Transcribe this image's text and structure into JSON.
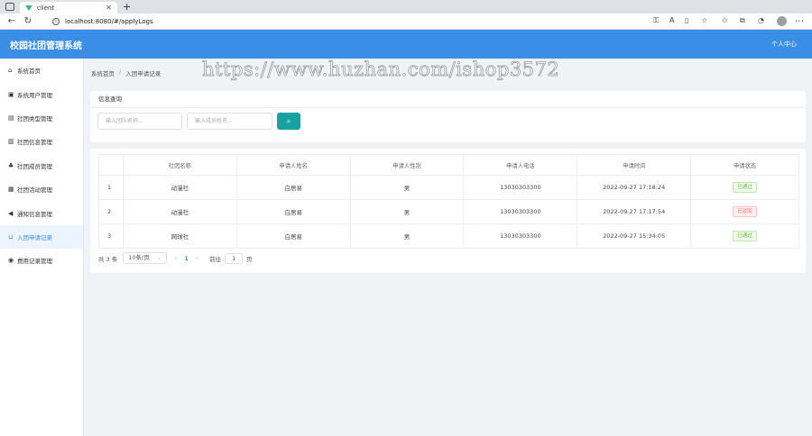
{
  "browser": {
    "tab_title": "client",
    "url": "localhost:8080/#/applyLogs"
  },
  "app": {
    "title": "校园社团管理系统",
    "user_center": "个人中心"
  },
  "sidebar": {
    "items": [
      {
        "icon": "home-icon",
        "glyph": "⌂",
        "label": "系统首页"
      },
      {
        "icon": "document-icon",
        "glyph": "▣",
        "label": "系统用户管理"
      },
      {
        "icon": "list-icon",
        "glyph": "▤",
        "label": "社团类型管理"
      },
      {
        "icon": "info-icon",
        "glyph": "▥",
        "label": "社团信息管理"
      },
      {
        "icon": "users-icon",
        "glyph": "♣",
        "label": "社团成员管理"
      },
      {
        "icon": "calendar-icon",
        "glyph": "▦",
        "label": "社团活动管理"
      },
      {
        "icon": "megaphone-icon",
        "glyph": "◀",
        "label": "通知信息管理"
      },
      {
        "icon": "tray-icon",
        "glyph": "⊔",
        "label": "入团申请记录"
      },
      {
        "icon": "money-icon",
        "glyph": "◉",
        "label": "费用记录管理"
      }
    ],
    "active_index": 7
  },
  "breadcrumb": {
    "home": "系统首页",
    "separator": "/",
    "current": "入团申请记录"
  },
  "watermark": "https://www.huzhan.com/ishop3572",
  "search": {
    "header": "信息查询",
    "team_placeholder": "输入团队名称...",
    "member_placeholder": "输入成员姓名..."
  },
  "table": {
    "columns": [
      "",
      "社团名称",
      "申请人姓名",
      "申请人性别",
      "申请人电话",
      "申请时间",
      "申请状态"
    ],
    "rows": [
      {
        "index": "1",
        "club": "动漫社",
        "name": "白居易",
        "gender": "男",
        "phone": "13030303300",
        "time": "2022-09-27 17:18:24",
        "status": "已通过",
        "status_type": "ok"
      },
      {
        "index": "2",
        "club": "动漫社",
        "name": "白居易",
        "gender": "男",
        "phone": "13030303300",
        "time": "2022-09-27 17:17:54",
        "status": "已驳回",
        "status_type": "rej"
      },
      {
        "index": "3",
        "club": "网球社",
        "name": "白居易",
        "gender": "男",
        "phone": "13030303300",
        "time": "2022-09-27 15:34:05",
        "status": "已通过",
        "status_type": "ok"
      }
    ]
  },
  "pagination": {
    "total": "共 3 条",
    "page_size": "10条/页",
    "current_page": "1",
    "goto_label": "前往",
    "goto_value": "1",
    "page_suffix": "页"
  },
  "colors": {
    "header_blue": "#3a8ee6",
    "search_teal": "#17a2a2",
    "success": "#67c23a",
    "danger": "#f56c6c"
  }
}
